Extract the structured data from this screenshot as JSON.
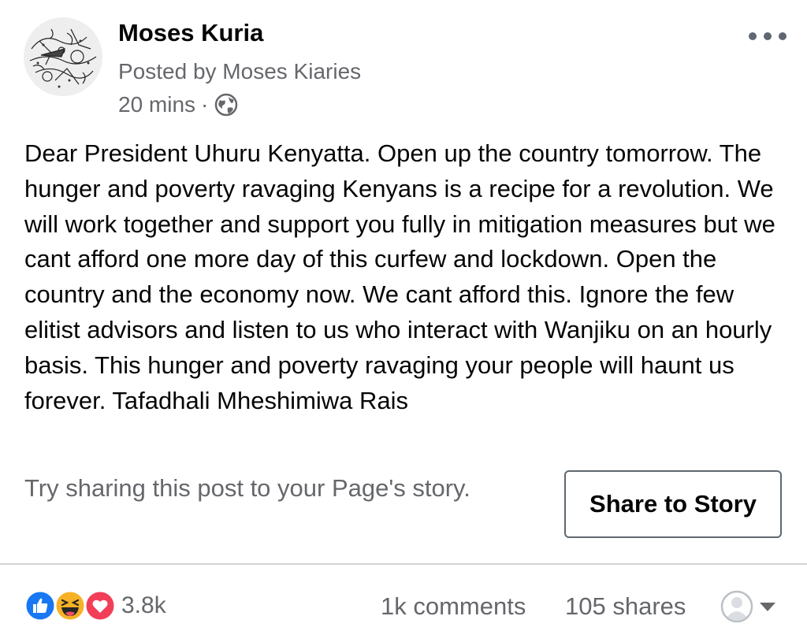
{
  "post": {
    "author_name": "Moses Kuria",
    "posted_by": "Posted by Moses Kiaries",
    "time": "20 mins",
    "separator": "·",
    "privacy_icon": "globe-icon",
    "menu_icon": "more-options-icon",
    "text": "Dear President Uhuru Kenyatta. Open up the country tomorrow. The hunger and poverty ravaging Kenyans is a recipe for a revolution. We will work together and support you fully in mitigation measures but we cant afford one more day of this curfew and lockdown. Open the country and the economy now. We cant afford this. Ignore the few elitist advisors and listen to us who interact with Wanjiku on an hourly basis. This hunger and poverty ravaging your people will haunt us forever. Tafadhali Mheshimiwa Rais"
  },
  "share_prompt": {
    "text": "Try sharing this post to your Page's story.",
    "button_label": "Share to Story"
  },
  "footer": {
    "reactions": {
      "icons": [
        "like-icon",
        "haha-icon",
        "love-icon"
      ],
      "count": "3.8k"
    },
    "comments": "1k comments",
    "shares": "105 shares",
    "page_selector_icons": [
      "page-avatar-icon",
      "caret-down-icon"
    ]
  },
  "colors": {
    "like_blue": "#1877f2",
    "love_red": "#f33e58",
    "haha_yellow": "#f7b125",
    "secondary_text": "#65676b",
    "divider": "#d0d2d5"
  }
}
